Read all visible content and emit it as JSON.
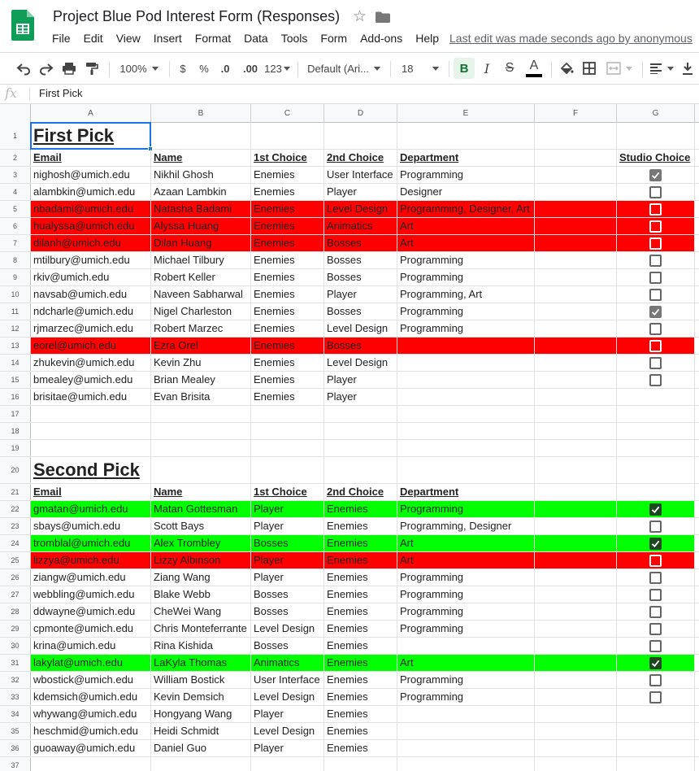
{
  "doc": {
    "title": "Project Blue Pod Interest Form (Responses)",
    "last_edit": "Last edit was made seconds ago by anonymous",
    "menus": [
      "File",
      "Edit",
      "View",
      "Insert",
      "Format",
      "Data",
      "Tools",
      "Form",
      "Add-ons",
      "Help"
    ]
  },
  "toolbar": {
    "zoom": "100%",
    "currency": "$",
    "percent": "%",
    "dec_less": ".0",
    "dec_more": ".00",
    "more_formats": "123",
    "font": "Default (Ari...",
    "font_size": "18",
    "bold": "B",
    "italic": "I",
    "strike": "S",
    "text_color": "A"
  },
  "formula_bar": {
    "fx": "fx",
    "value": "First Pick"
  },
  "columns": [
    "A",
    "B",
    "C",
    "D",
    "E",
    "F",
    "G"
  ],
  "colors": {
    "red_row": "#ff0000",
    "green_row": "#00ff00",
    "selection": "#1a73e8"
  },
  "rows": [
    {
      "n": "1",
      "type": "title",
      "cells": [
        "First Pick",
        "",
        "",
        "",
        "",
        ""
      ]
    },
    {
      "n": "2",
      "type": "header",
      "cells": [
        "Email",
        "Name",
        "1st Choice",
        "2nd Choice",
        "Department",
        "",
        "Studio Choice"
      ]
    },
    {
      "n": "3",
      "cells": [
        "nighosh@umich.edu",
        "Nikhil Ghosh",
        "Enemies",
        "User Interface",
        "Programming",
        ""
      ],
      "check": true
    },
    {
      "n": "4",
      "cells": [
        "alambkin@umich.edu",
        "Azaan Lambkin",
        "Enemies",
        "Player",
        "Designer",
        ""
      ],
      "check": false
    },
    {
      "n": "5",
      "hl": "red",
      "cells": [
        "nbadami@umich.edu",
        "Natasha Badami",
        "Enemies",
        "Level Design",
        "Programming, Designer, Art",
        ""
      ],
      "check": false
    },
    {
      "n": "6",
      "hl": "red",
      "cells": [
        "hualyssa@umich.edu",
        "Alyssa Huang",
        "Enemies",
        "Animatics",
        "Art",
        ""
      ],
      "check": false
    },
    {
      "n": "7",
      "hl": "red",
      "cells": [
        "dilanh@umich.edu",
        "Dilan Huang",
        "Enemies",
        "Bosses",
        "Art",
        ""
      ],
      "check": false
    },
    {
      "n": "8",
      "cells": [
        "mtilbury@umich.edu",
        "Michael Tilbury",
        "Enemies",
        "Bosses",
        "Programming",
        ""
      ],
      "check": false
    },
    {
      "n": "9",
      "cells": [
        "rkiv@umich.edu",
        "Robert Keller",
        "Enemies",
        "Bosses",
        "Programming",
        ""
      ],
      "check": false
    },
    {
      "n": "10",
      "cells": [
        "navsab@umich.edu",
        "Naveen Sabharwal",
        "Enemies",
        "Player",
        "Programming, Art",
        ""
      ],
      "check": false
    },
    {
      "n": "11",
      "cells": [
        "ndcharle@umich.edu",
        "Nigel Charleston",
        "Enemies",
        "Bosses",
        "Programming",
        ""
      ],
      "check": true
    },
    {
      "n": "12",
      "cells": [
        "rjmarzec@umich.edu",
        "Robert Marzec",
        "Enemies",
        "Level Design",
        "Programming",
        ""
      ],
      "check": false
    },
    {
      "n": "13",
      "hl": "red",
      "cells": [
        "eorel@umich.edu",
        "Ezra Orel",
        "Enemies",
        "Bosses",
        "",
        ""
      ],
      "check": false
    },
    {
      "n": "14",
      "cells": [
        "zhukevin@umich.edu",
        "Kevin Zhu",
        "Enemies",
        "Level Design",
        "",
        ""
      ],
      "check": false
    },
    {
      "n": "15",
      "cells": [
        "bmealey@umich.edu",
        "Brian Mealey",
        "Enemies",
        "Player",
        "",
        ""
      ],
      "check": false
    },
    {
      "n": "16",
      "cells": [
        "brisitae@umich.edu",
        "Evan Brisita",
        "Enemies",
        "Player",
        "",
        ""
      ]
    },
    {
      "n": "17",
      "cells": [
        "",
        "",
        "",
        "",
        "",
        ""
      ]
    },
    {
      "n": "18",
      "cells": [
        "",
        "",
        "",
        "",
        "",
        ""
      ]
    },
    {
      "n": "19",
      "cells": [
        "",
        "",
        "",
        "",
        "",
        ""
      ]
    },
    {
      "n": "20",
      "type": "title",
      "cells": [
        "Second Pick",
        "",
        "",
        "",
        "",
        ""
      ]
    },
    {
      "n": "21",
      "type": "header",
      "cells": [
        "Email",
        "Name",
        "1st Choice",
        "2nd Choice",
        "Department",
        ""
      ]
    },
    {
      "n": "22",
      "hl": "green",
      "cells": [
        "gmatan@umich.edu",
        "Matan Gottesman",
        "Player",
        "Enemies",
        "Programming",
        ""
      ],
      "check": true
    },
    {
      "n": "23",
      "cells": [
        "sbays@umich.edu",
        "Scott Bays",
        "Player",
        "Enemies",
        "Programming, Designer",
        ""
      ],
      "check": false
    },
    {
      "n": "24",
      "hl": "green",
      "cells": [
        "tromblal@umich.edu",
        "Alex Trombley",
        "Bosses",
        "Enemies",
        "Art",
        ""
      ],
      "check": true
    },
    {
      "n": "25",
      "hl": "red",
      "cells": [
        "lizzya@umich.edu",
        "Lizzy Albinson",
        "Player",
        "Enemies",
        "Art",
        ""
      ],
      "check": false
    },
    {
      "n": "26",
      "cells": [
        "ziangw@umich.edu",
        "Ziang Wang",
        "Player",
        "Enemies",
        "Programming",
        ""
      ],
      "check": false
    },
    {
      "n": "27",
      "cells": [
        "webbling@umich.edu",
        "Blake Webb",
        "Bosses",
        "Enemies",
        "Programming",
        ""
      ],
      "check": false
    },
    {
      "n": "28",
      "cells": [
        "ddwayne@umich.edu",
        "CheWei Wang",
        "Bosses",
        "Enemies",
        "Programming",
        ""
      ],
      "check": false
    },
    {
      "n": "29",
      "cells": [
        "cpmonte@umich.edu",
        "Chris Monteferrante",
        "Level Design",
        "Enemies",
        "Programming",
        ""
      ],
      "check": false
    },
    {
      "n": "30",
      "cells": [
        "krina@umich.edu",
        "Rina Kishida",
        "Bosses",
        "Enemies",
        "",
        ""
      ],
      "check": false
    },
    {
      "n": "31",
      "hl": "green",
      "cells": [
        "lakylat@umich.edu",
        "LaKyla Thomas",
        "Animatics",
        "Enemies",
        "Art",
        ""
      ],
      "check": true
    },
    {
      "n": "32",
      "cells": [
        "wbostick@umich.edu",
        "William Bostick",
        "User Interface",
        "Enemies",
        "Programming",
        ""
      ],
      "check": false
    },
    {
      "n": "33",
      "cells": [
        "kdemsich@umich.edu",
        "Kevin Demsich",
        "Level Design",
        "Enemies",
        "Programming",
        ""
      ],
      "check": false
    },
    {
      "n": "34",
      "cells": [
        "whywang@umich.edu",
        "Hongyang Wang",
        "Player",
        "Enemies",
        "",
        ""
      ]
    },
    {
      "n": "35",
      "cells": [
        "heschmid@umich.edu",
        "Heidi Schmidt",
        "Level Design",
        "Enemies",
        "",
        ""
      ]
    },
    {
      "n": "36",
      "cells": [
        "guoaway@umich.edu",
        "Daniel Guo",
        "Player",
        "Enemies",
        "",
        ""
      ]
    },
    {
      "n": "37",
      "cells": [
        "",
        "",
        "",
        "",
        "",
        ""
      ]
    }
  ]
}
